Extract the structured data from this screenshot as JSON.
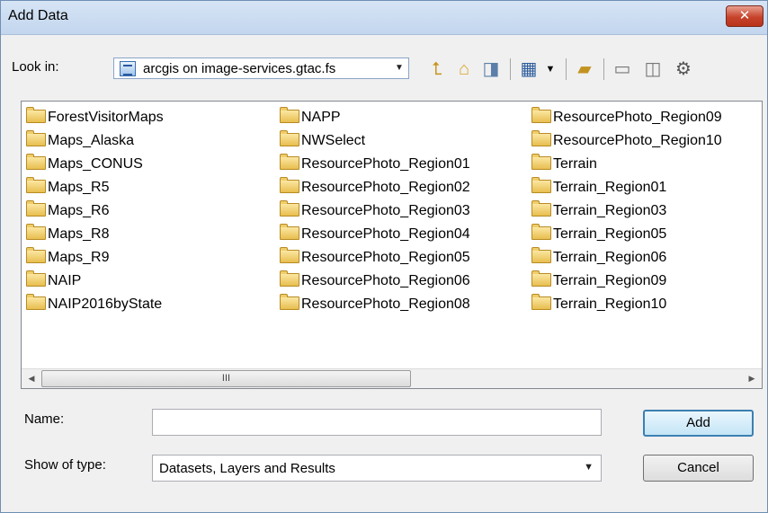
{
  "window": {
    "title": "Add Data",
    "close_label": "✕"
  },
  "toolbar": {
    "lookin_label": "Look in:",
    "lookin_value": "arcgis on image-services.gtac.fs",
    "icons": [
      "up-one-level-icon",
      "home-icon",
      "connect-folder-icon",
      "list-view-icon",
      "new-folder-icon",
      "disconnect-icon",
      "delete-icon",
      "options-icon"
    ]
  },
  "files": {
    "col1": [
      "ForestVisitorMaps",
      "Maps_Alaska",
      "Maps_CONUS",
      "Maps_R5",
      "Maps_R6",
      "Maps_R8",
      "Maps_R9",
      "NAIP",
      "NAIP2016byState"
    ],
    "col2": [
      "NAPP",
      "NWSelect",
      "ResourcePhoto_Region01",
      "ResourcePhoto_Region02",
      "ResourcePhoto_Region03",
      "ResourcePhoto_Region04",
      "ResourcePhoto_Region05",
      "ResourcePhoto_Region06",
      "ResourcePhoto_Region08"
    ],
    "col3": [
      "ResourcePhoto_Region09",
      "ResourcePhoto_Region10",
      "Terrain",
      "Terrain_Region01",
      "Terrain_Region03",
      "Terrain_Region05",
      "Terrain_Region06",
      "Terrain_Region09",
      "Terrain_Region10"
    ]
  },
  "scrollbar": {
    "thumb_grip": "III"
  },
  "form": {
    "name_label": "Name:",
    "name_value": "",
    "type_label": "Show of type:",
    "type_value": "Datasets, Layers and Results",
    "add_label": "Add",
    "cancel_label": "Cancel"
  }
}
